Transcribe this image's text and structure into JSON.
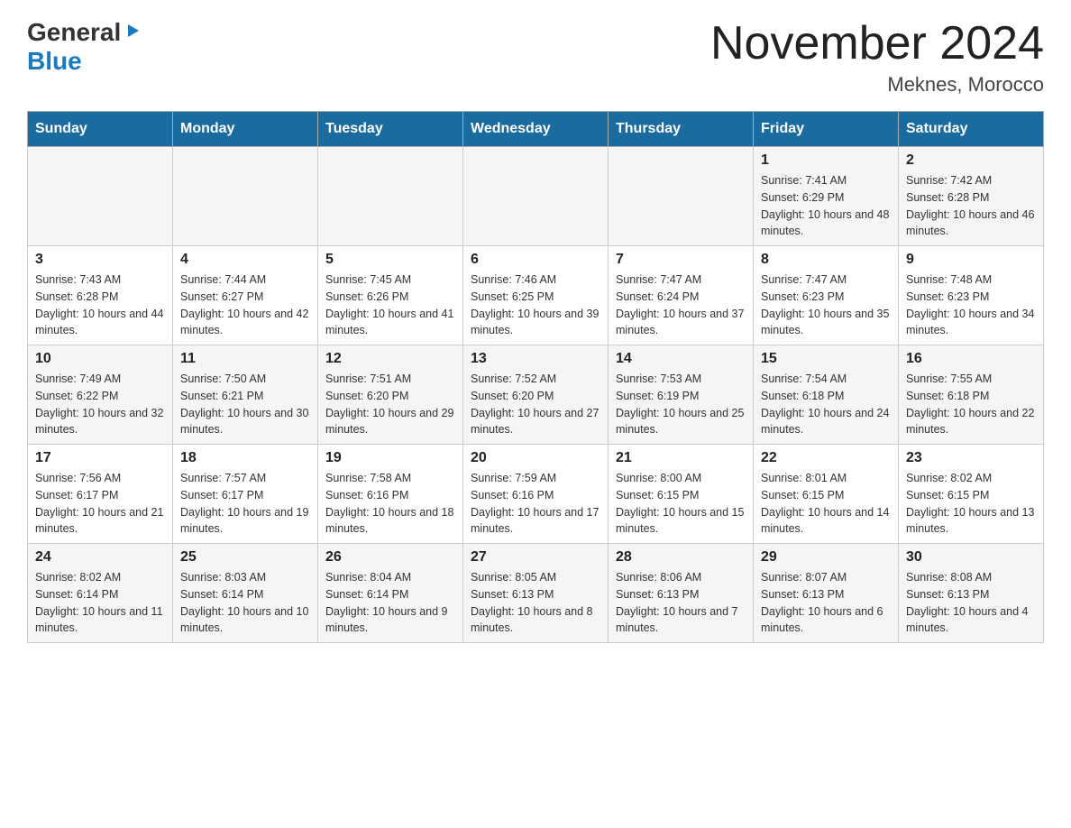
{
  "header": {
    "logo_general": "General",
    "logo_blue": "Blue",
    "month_title": "November 2024",
    "location": "Meknes, Morocco"
  },
  "weekdays": [
    "Sunday",
    "Monday",
    "Tuesday",
    "Wednesday",
    "Thursday",
    "Friday",
    "Saturday"
  ],
  "weeks": [
    [
      {
        "day": "",
        "sunrise": "",
        "sunset": "",
        "daylight": ""
      },
      {
        "day": "",
        "sunrise": "",
        "sunset": "",
        "daylight": ""
      },
      {
        "day": "",
        "sunrise": "",
        "sunset": "",
        "daylight": ""
      },
      {
        "day": "",
        "sunrise": "",
        "sunset": "",
        "daylight": ""
      },
      {
        "day": "",
        "sunrise": "",
        "sunset": "",
        "daylight": ""
      },
      {
        "day": "1",
        "sunrise": "Sunrise: 7:41 AM",
        "sunset": "Sunset: 6:29 PM",
        "daylight": "Daylight: 10 hours and 48 minutes."
      },
      {
        "day": "2",
        "sunrise": "Sunrise: 7:42 AM",
        "sunset": "Sunset: 6:28 PM",
        "daylight": "Daylight: 10 hours and 46 minutes."
      }
    ],
    [
      {
        "day": "3",
        "sunrise": "Sunrise: 7:43 AM",
        "sunset": "Sunset: 6:28 PM",
        "daylight": "Daylight: 10 hours and 44 minutes."
      },
      {
        "day": "4",
        "sunrise": "Sunrise: 7:44 AM",
        "sunset": "Sunset: 6:27 PM",
        "daylight": "Daylight: 10 hours and 42 minutes."
      },
      {
        "day": "5",
        "sunrise": "Sunrise: 7:45 AM",
        "sunset": "Sunset: 6:26 PM",
        "daylight": "Daylight: 10 hours and 41 minutes."
      },
      {
        "day": "6",
        "sunrise": "Sunrise: 7:46 AM",
        "sunset": "Sunset: 6:25 PM",
        "daylight": "Daylight: 10 hours and 39 minutes."
      },
      {
        "day": "7",
        "sunrise": "Sunrise: 7:47 AM",
        "sunset": "Sunset: 6:24 PM",
        "daylight": "Daylight: 10 hours and 37 minutes."
      },
      {
        "day": "8",
        "sunrise": "Sunrise: 7:47 AM",
        "sunset": "Sunset: 6:23 PM",
        "daylight": "Daylight: 10 hours and 35 minutes."
      },
      {
        "day": "9",
        "sunrise": "Sunrise: 7:48 AM",
        "sunset": "Sunset: 6:23 PM",
        "daylight": "Daylight: 10 hours and 34 minutes."
      }
    ],
    [
      {
        "day": "10",
        "sunrise": "Sunrise: 7:49 AM",
        "sunset": "Sunset: 6:22 PM",
        "daylight": "Daylight: 10 hours and 32 minutes."
      },
      {
        "day": "11",
        "sunrise": "Sunrise: 7:50 AM",
        "sunset": "Sunset: 6:21 PM",
        "daylight": "Daylight: 10 hours and 30 minutes."
      },
      {
        "day": "12",
        "sunrise": "Sunrise: 7:51 AM",
        "sunset": "Sunset: 6:20 PM",
        "daylight": "Daylight: 10 hours and 29 minutes."
      },
      {
        "day": "13",
        "sunrise": "Sunrise: 7:52 AM",
        "sunset": "Sunset: 6:20 PM",
        "daylight": "Daylight: 10 hours and 27 minutes."
      },
      {
        "day": "14",
        "sunrise": "Sunrise: 7:53 AM",
        "sunset": "Sunset: 6:19 PM",
        "daylight": "Daylight: 10 hours and 25 minutes."
      },
      {
        "day": "15",
        "sunrise": "Sunrise: 7:54 AM",
        "sunset": "Sunset: 6:18 PM",
        "daylight": "Daylight: 10 hours and 24 minutes."
      },
      {
        "day": "16",
        "sunrise": "Sunrise: 7:55 AM",
        "sunset": "Sunset: 6:18 PM",
        "daylight": "Daylight: 10 hours and 22 minutes."
      }
    ],
    [
      {
        "day": "17",
        "sunrise": "Sunrise: 7:56 AM",
        "sunset": "Sunset: 6:17 PM",
        "daylight": "Daylight: 10 hours and 21 minutes."
      },
      {
        "day": "18",
        "sunrise": "Sunrise: 7:57 AM",
        "sunset": "Sunset: 6:17 PM",
        "daylight": "Daylight: 10 hours and 19 minutes."
      },
      {
        "day": "19",
        "sunrise": "Sunrise: 7:58 AM",
        "sunset": "Sunset: 6:16 PM",
        "daylight": "Daylight: 10 hours and 18 minutes."
      },
      {
        "day": "20",
        "sunrise": "Sunrise: 7:59 AM",
        "sunset": "Sunset: 6:16 PM",
        "daylight": "Daylight: 10 hours and 17 minutes."
      },
      {
        "day": "21",
        "sunrise": "Sunrise: 8:00 AM",
        "sunset": "Sunset: 6:15 PM",
        "daylight": "Daylight: 10 hours and 15 minutes."
      },
      {
        "day": "22",
        "sunrise": "Sunrise: 8:01 AM",
        "sunset": "Sunset: 6:15 PM",
        "daylight": "Daylight: 10 hours and 14 minutes."
      },
      {
        "day": "23",
        "sunrise": "Sunrise: 8:02 AM",
        "sunset": "Sunset: 6:15 PM",
        "daylight": "Daylight: 10 hours and 13 minutes."
      }
    ],
    [
      {
        "day": "24",
        "sunrise": "Sunrise: 8:02 AM",
        "sunset": "Sunset: 6:14 PM",
        "daylight": "Daylight: 10 hours and 11 minutes."
      },
      {
        "day": "25",
        "sunrise": "Sunrise: 8:03 AM",
        "sunset": "Sunset: 6:14 PM",
        "daylight": "Daylight: 10 hours and 10 minutes."
      },
      {
        "day": "26",
        "sunrise": "Sunrise: 8:04 AM",
        "sunset": "Sunset: 6:14 PM",
        "daylight": "Daylight: 10 hours and 9 minutes."
      },
      {
        "day": "27",
        "sunrise": "Sunrise: 8:05 AM",
        "sunset": "Sunset: 6:13 PM",
        "daylight": "Daylight: 10 hours and 8 minutes."
      },
      {
        "day": "28",
        "sunrise": "Sunrise: 8:06 AM",
        "sunset": "Sunset: 6:13 PM",
        "daylight": "Daylight: 10 hours and 7 minutes."
      },
      {
        "day": "29",
        "sunrise": "Sunrise: 8:07 AM",
        "sunset": "Sunset: 6:13 PM",
        "daylight": "Daylight: 10 hours and 6 minutes."
      },
      {
        "day": "30",
        "sunrise": "Sunrise: 8:08 AM",
        "sunset": "Sunset: 6:13 PM",
        "daylight": "Daylight: 10 hours and 4 minutes."
      }
    ]
  ]
}
